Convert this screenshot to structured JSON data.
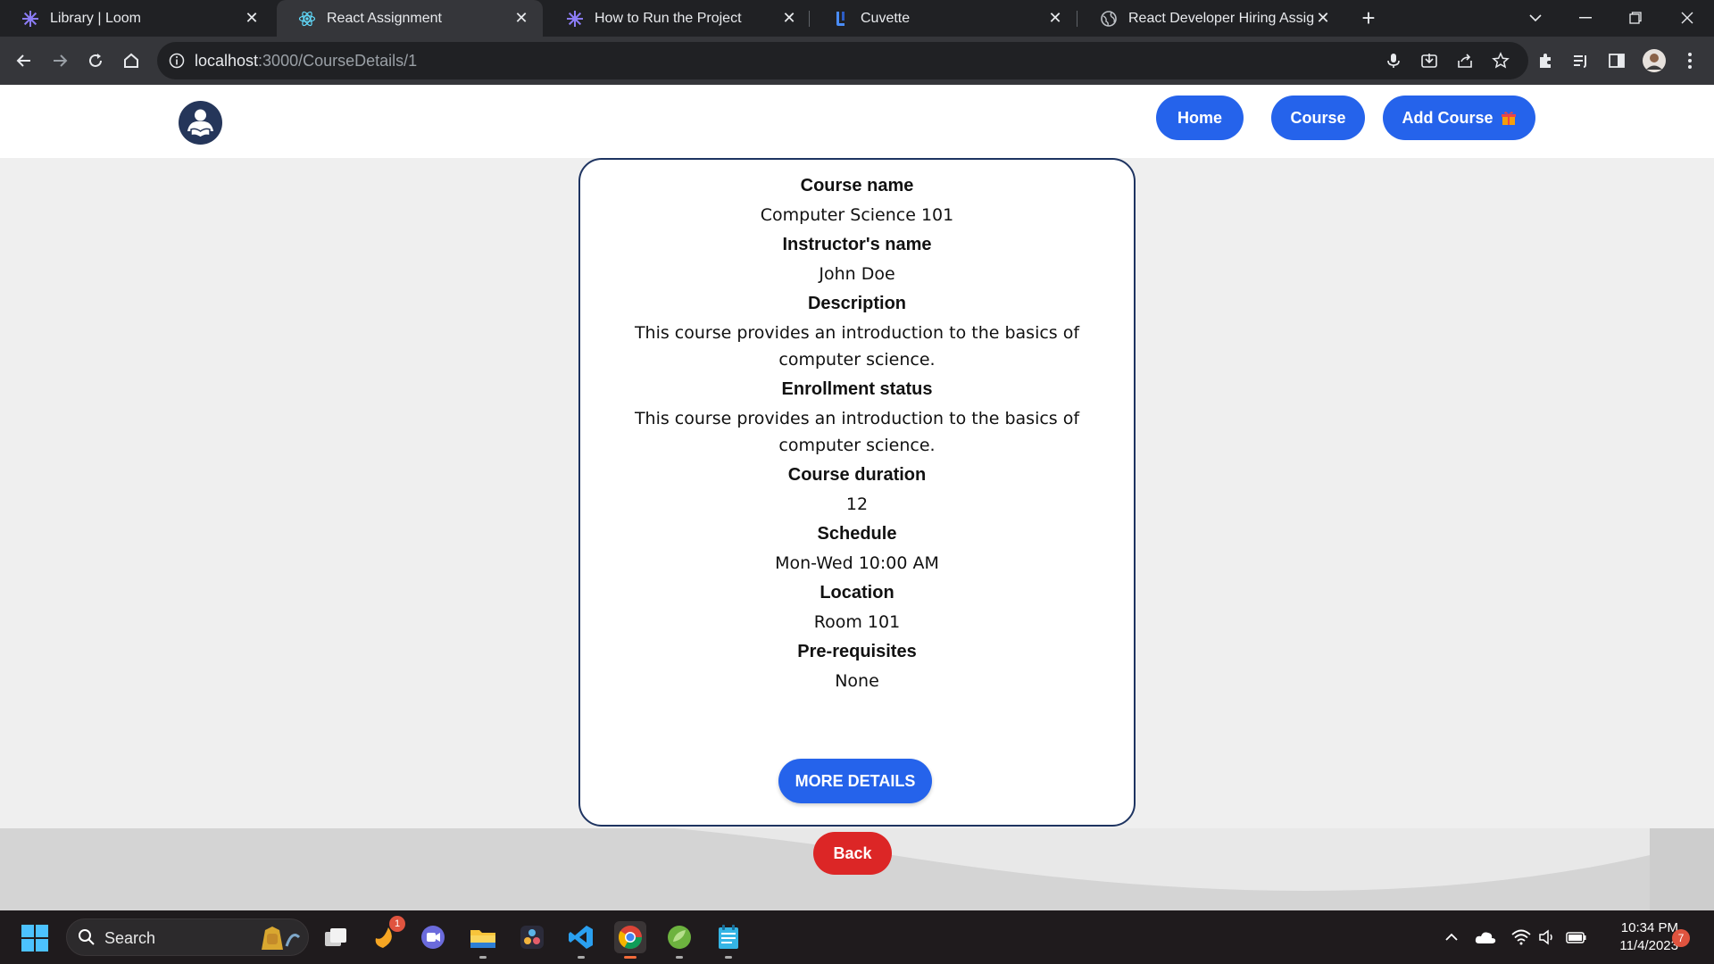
{
  "browser": {
    "tabs": [
      {
        "title": "Library | Loom",
        "icon": "loom-icon"
      },
      {
        "title": "React Assignment",
        "icon": "react-icon"
      },
      {
        "title": "How to Run the Project",
        "icon": "loom-icon"
      },
      {
        "title": "Cuvette",
        "icon": "cuvette-icon"
      },
      {
        "title": "React Developer Hiring Assignm",
        "icon": "globe-icon"
      }
    ],
    "url_host": "localhost",
    "url_path": ":3000/CourseDetails/1"
  },
  "header": {
    "nav": {
      "home": "Home",
      "course": "Course",
      "add_course": "Add Course"
    }
  },
  "course": {
    "fields": [
      {
        "label": "Course name",
        "value": "Computer Science 101"
      },
      {
        "label": "Instructor's name",
        "value": "John Doe"
      },
      {
        "label": "Description",
        "value": "This course provides an introduction to the basics of computer science."
      },
      {
        "label": "Enrollment status",
        "value": "This course provides an introduction to the basics of computer science."
      },
      {
        "label": "Course duration",
        "value": "12"
      },
      {
        "label": "Schedule",
        "value": "Mon-Wed 10:00 AM"
      },
      {
        "label": "Location",
        "value": "Room 101"
      },
      {
        "label": "Pre-requisites",
        "value": "None"
      }
    ],
    "more_button": "MORE DETAILS"
  },
  "footer": {
    "back_button": "Back"
  },
  "taskbar": {
    "search_label": "Search",
    "badge_count": "1",
    "time": "10:34 PM",
    "date": "11/4/2023",
    "notification_count": "7"
  },
  "colors": {
    "primary_button": "#2563eb",
    "back_button": "#dc2626",
    "card_border": "#1e3461"
  }
}
